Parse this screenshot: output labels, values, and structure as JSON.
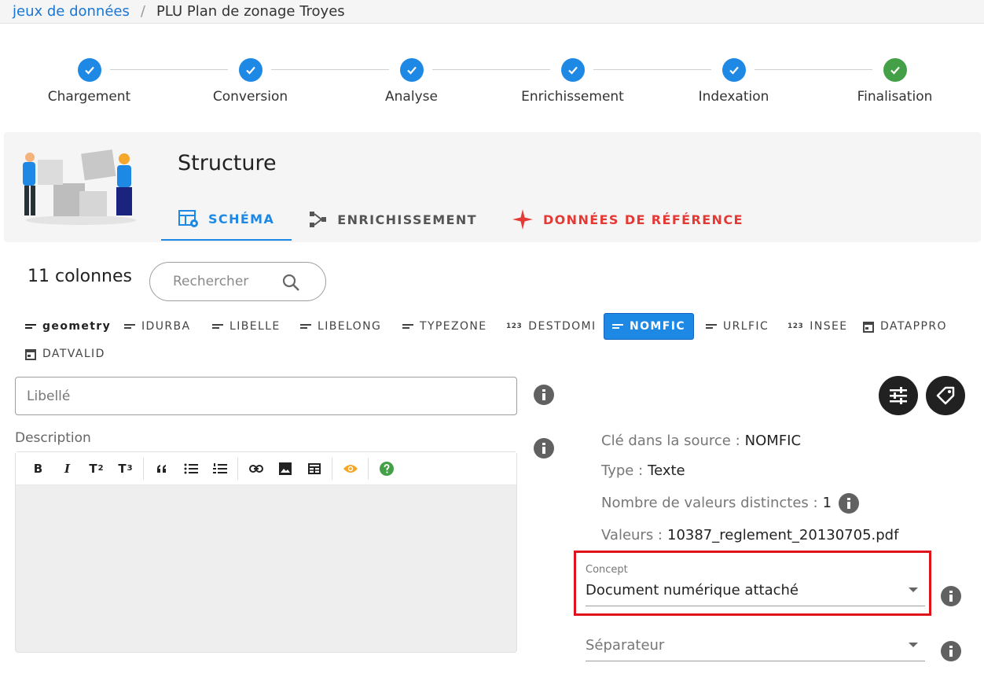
{
  "breadcrumb": {
    "root": "jeux de données",
    "separator": "/",
    "current": "PLU Plan de zonage Troyes"
  },
  "stepper": {
    "steps": [
      {
        "label": "Chargement",
        "status": "done"
      },
      {
        "label": "Conversion",
        "status": "done"
      },
      {
        "label": "Analyse",
        "status": "done"
      },
      {
        "label": "Enrichissement",
        "status": "done"
      },
      {
        "label": "Indexation",
        "status": "done"
      },
      {
        "label": "Finalisation",
        "status": "completed"
      }
    ]
  },
  "header": {
    "title": "Structure",
    "tabs": [
      {
        "label": "SCHÉMA",
        "icon": "table-settings-icon",
        "active": true
      },
      {
        "label": "ENRICHISSEMENT",
        "icon": "graph-icon",
        "active": false
      },
      {
        "label": "DONNÉES DE RÉFÉRENCE",
        "icon": "sparkle-icon",
        "active": false
      }
    ]
  },
  "columns": {
    "count_label": "11 colonnes",
    "search_placeholder": "Rechercher",
    "chips": [
      {
        "label": "geometry",
        "icon": "text-icon"
      },
      {
        "label": "IDURBA",
        "icon": "text-icon"
      },
      {
        "label": "LIBELLE",
        "icon": "text-icon"
      },
      {
        "label": "LIBELONG",
        "icon": "text-icon"
      },
      {
        "label": "TYPEZONE",
        "icon": "text-icon"
      },
      {
        "label": "DESTDOMI",
        "icon": "number-icon"
      },
      {
        "label": "NOMFIC",
        "icon": "text-icon",
        "active": true
      },
      {
        "label": "URLFIC",
        "icon": "text-icon"
      },
      {
        "label": "INSEE",
        "icon": "number-icon"
      },
      {
        "label": "DATAPPRO",
        "icon": "calendar-icon"
      },
      {
        "label": "DATVALID",
        "icon": "calendar-icon"
      }
    ],
    "number_icon_text": "123"
  },
  "form": {
    "libelle_placeholder": "Libellé",
    "description_label": "Description",
    "toolbar": {
      "bold": "B",
      "italic": "I",
      "t": "T",
      "sub2": "2",
      "sub3": "3"
    }
  },
  "details": {
    "source_key_label": "Clé dans la source :",
    "source_key_value": "NOMFIC",
    "type_label": "Type :",
    "type_value": "Texte",
    "distinct_label": "Nombre de valeurs distinctes :",
    "distinct_value": "1",
    "values_label": "Valeurs :",
    "values_value": "10387_reglement_20130705.pdf",
    "concept_label": "Concept",
    "concept_value": "Document numérique attaché",
    "separator_placeholder": "Séparateur"
  },
  "colors": {
    "primary": "#1e88e5",
    "success": "#43a047",
    "highlight": "#e0131c",
    "reference": "#e53935"
  }
}
